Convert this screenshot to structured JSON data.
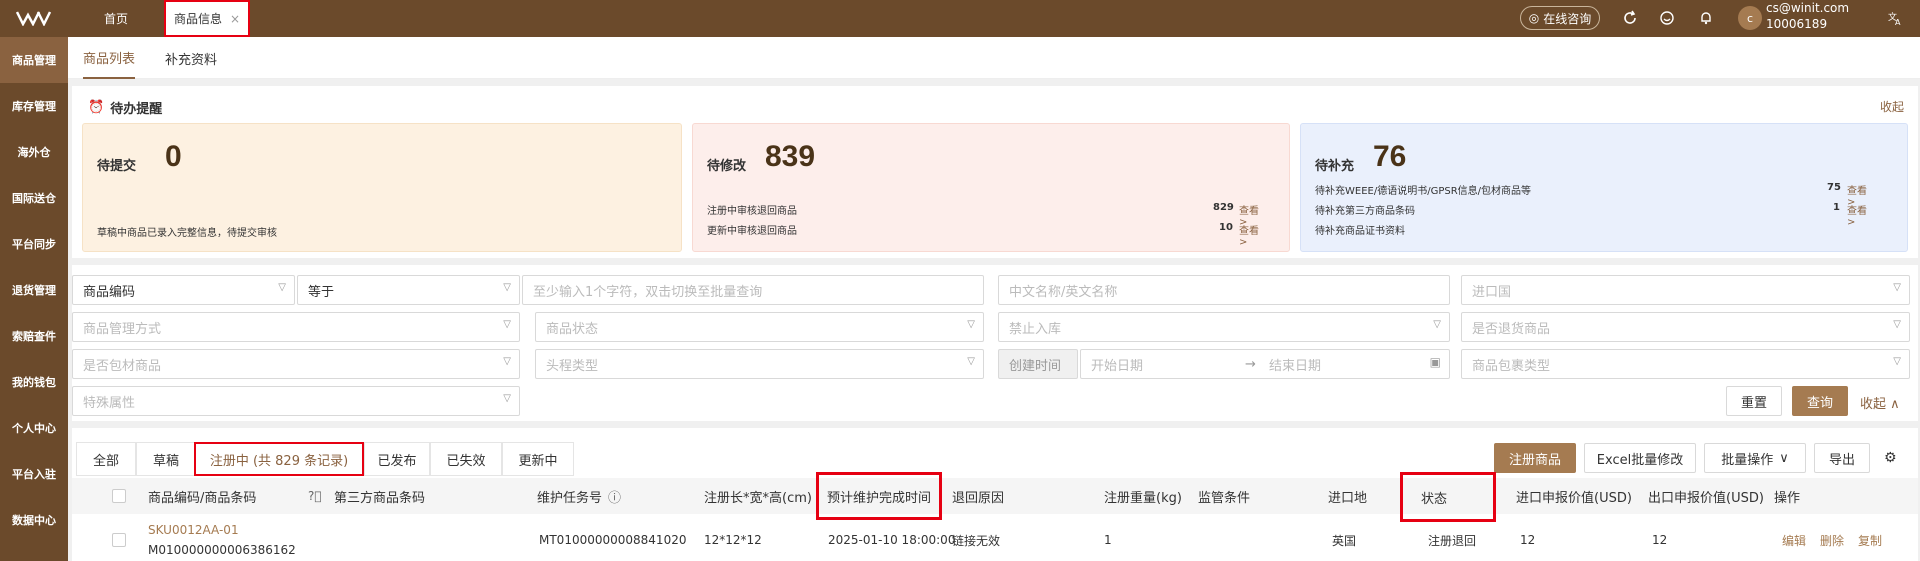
{
  "topbar": {
    "home_tab": "首页",
    "active_tab": "商品信息",
    "close": "×",
    "consult": "在线咨询",
    "email": "cs@winit.com",
    "account": "10006189",
    "avatar_letter": "c"
  },
  "sidebar": [
    "商品管理",
    "库存管理",
    "海外仓",
    "国际送仓",
    "平台同步",
    "退货管理",
    "索赔查件",
    "我的钱包",
    "个人中心",
    "平台入驻",
    "数据中心"
  ],
  "subtabs": [
    "商品列表",
    "补充资料"
  ],
  "todo": {
    "title": "待办提醒",
    "collapse": "收起",
    "submit": {
      "label": "待提交",
      "count": "0",
      "desc": "草稿中商品已录入完整信息，待提交审核"
    },
    "modify": {
      "label": "待修改",
      "count": "839",
      "rows": [
        {
          "text": "注册中审核退回商品",
          "count": "829",
          "link": "查看 >"
        },
        {
          "text": "更新中审核退回商品",
          "count": "10",
          "link": "查看 >"
        }
      ]
    },
    "supplement": {
      "label": "待补充",
      "count": "76",
      "rows": [
        {
          "text": "待补充WEEE/德语说明书/GPSR信息/包材商品等",
          "count": "75",
          "link": "查看 >"
        },
        {
          "text": "待补充第三方商品条码",
          "count": "1",
          "link": "查看 >"
        },
        {
          "text": "待补充商品证书资料",
          "count": "",
          "link": ""
        }
      ]
    }
  },
  "filters": {
    "field": "商品编码",
    "op": "等于",
    "query_ph": "至少输入1个字符，双击切换至批量查询",
    "name_ph": "中文名称/英文名称",
    "import_ph": "进口国",
    "manage_ph": "商品管理方式",
    "status_ph": "商品状态",
    "forbid_ph": "禁止入库",
    "return_ph": "是否退货商品",
    "pack_ph": "是否包材商品",
    "head_ph": "头程类型",
    "created": "创建时间",
    "start_ph": "开始日期",
    "end_ph": "结束日期",
    "arrow": "→",
    "pkgtype_ph": "商品包裹类型",
    "special_ph": "特殊属性",
    "reset": "重置",
    "search": "查询",
    "collapse": "收起"
  },
  "status_tabs": [
    "全部",
    "草稿",
    "注册中 (共 829 条记录)",
    "已发布",
    "已失效",
    "更新中"
  ],
  "actions": {
    "register": "注册商品",
    "excel": "Excel批量修改",
    "batch": "批量操作",
    "export": "导出"
  },
  "columns": [
    "商品编码/商品条码",
    "第三方商品条码",
    "维护任务号",
    "注册长*宽*高(cm)",
    "预计维护完成时间",
    "退回原因",
    "注册重量(kg)",
    "监管条件",
    "进口地",
    "状态",
    "进口申报价值(USD)",
    "出口申报价值(USD)",
    "操作"
  ],
  "row": {
    "sku": "SKU0012AA-01",
    "barcode": "M010000000006386162",
    "task": "MT01000000008841020",
    "dims": "12*12*12",
    "eta": "2025-01-10 18:00:00",
    "reason": "链接无效",
    "weight": "1",
    "import": "英国",
    "status": "注册退回",
    "imp_val": "12",
    "exp_val": "12",
    "op_edit": "编辑",
    "op_del": "删除",
    "op_copy": "复制"
  }
}
